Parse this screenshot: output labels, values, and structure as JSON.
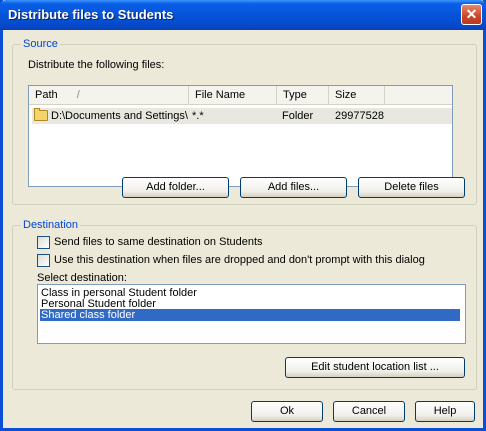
{
  "window": {
    "title": "Distribute files to Students",
    "close_label": "✕"
  },
  "source": {
    "legend": "Source",
    "caption": "Distribute the following files:",
    "columns": [
      {
        "label": "Path",
        "sort_indicator": "/"
      },
      {
        "label": "File Name"
      },
      {
        "label": "Type"
      },
      {
        "label": "Size"
      }
    ],
    "rows": [
      {
        "path": "D:\\Documents and Settings\\...",
        "file_name": "*.*",
        "type": "Folder",
        "size": "29977528",
        "icon": "folder-icon"
      }
    ],
    "buttons": {
      "add_folder": "Add folder...",
      "add_files": "Add files...",
      "delete_files": "Delete files"
    }
  },
  "destination": {
    "legend": "Destination",
    "option_same": "Send files to same destination on Students",
    "option_same_checked": false,
    "option_no_prompt": "Use this destination when files are dropped and don't prompt with this dialog",
    "option_no_prompt_checked": false,
    "select_label": "Select destination:",
    "items": [
      {
        "label": "Class in personal Student folder",
        "selected": false
      },
      {
        "label": "Personal Student folder",
        "selected": false
      },
      {
        "label": "Shared class folder",
        "selected": true
      }
    ],
    "edit_button": "Edit student location list ..."
  },
  "footer": {
    "ok": "Ok",
    "cancel": "Cancel",
    "help": "Help"
  },
  "colors": {
    "title_bar": "#0553d8",
    "legend": "#0046d5",
    "selection": "#316ac5",
    "close": "#c9462a"
  }
}
